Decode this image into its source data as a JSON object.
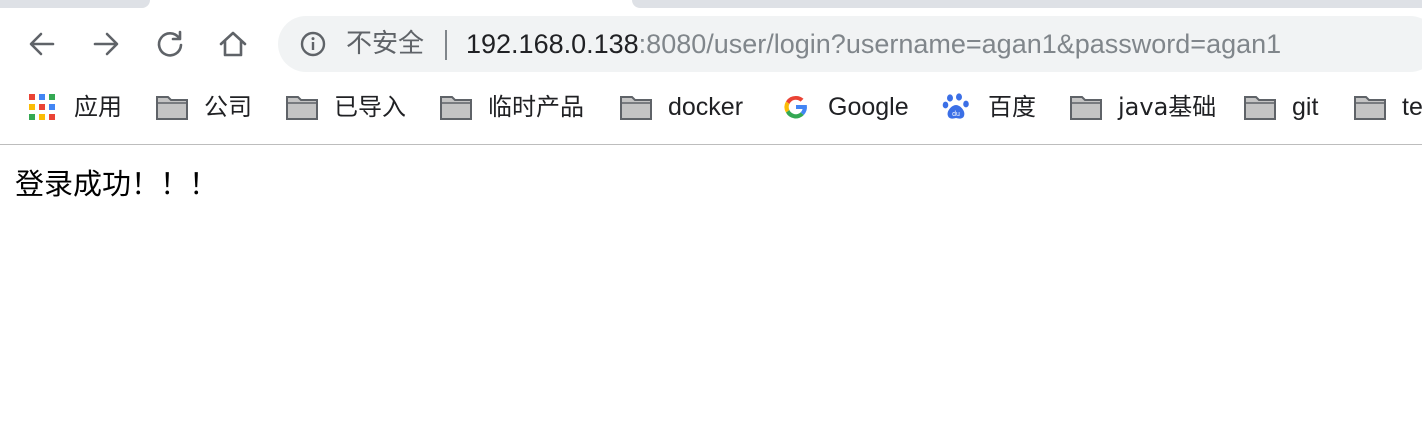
{
  "browser": {
    "security_label": "不安全",
    "url_host": "192.168.0.138",
    "url_rest": ":8080/user/login?username=agan1&password=agan1",
    "icons": {
      "back": "arrow-left-icon",
      "forward": "arrow-right-icon",
      "reload": "reload-icon",
      "home": "home-icon",
      "info": "info-icon"
    }
  },
  "bookmarks": [
    {
      "label": "应用",
      "icon": "apps-grid-icon"
    },
    {
      "label": "公司",
      "icon": "folder-icon"
    },
    {
      "label": "已导入",
      "icon": "folder-icon"
    },
    {
      "label": "临时产品",
      "icon": "folder-icon"
    },
    {
      "label": "docker",
      "icon": "folder-icon"
    },
    {
      "label": "Google",
      "icon": "google-icon"
    },
    {
      "label": "百度",
      "icon": "baidu-paw-icon"
    },
    {
      "label": "java基础",
      "icon": "folder-icon"
    },
    {
      "label": "git",
      "icon": "folder-icon"
    },
    {
      "label": "te",
      "icon": "folder-icon"
    }
  ],
  "page": {
    "message": "登录成功！！！"
  },
  "colors": {
    "omnibox_bg": "#f1f3f4",
    "icon_gray": "#5f6368",
    "url_dim": "#80868b",
    "text_dark": "#202124"
  }
}
